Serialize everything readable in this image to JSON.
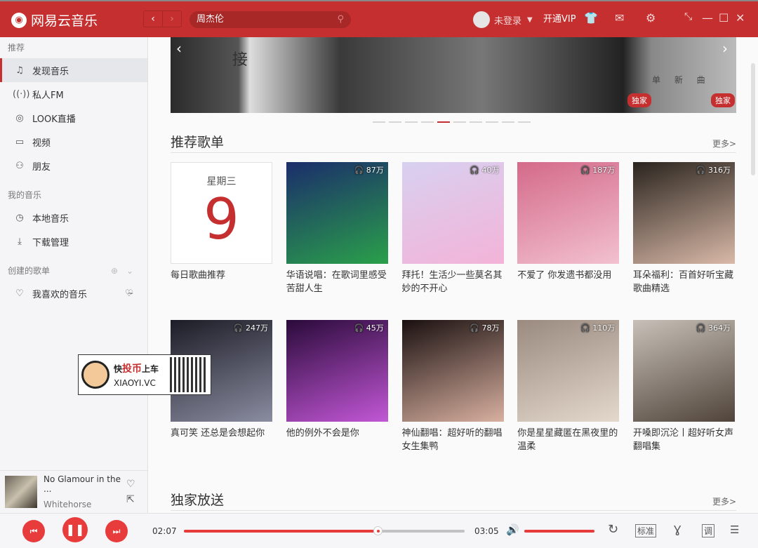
{
  "app": {
    "title": "网易云音乐",
    "search_value": "周杰伦",
    "user": "未登录",
    "vip": "开通VIP"
  },
  "sidebar": {
    "sections": [
      {
        "header": "推荐",
        "items": [
          {
            "label": "发现音乐",
            "icon": "music-note-icon",
            "active": true
          },
          {
            "label": "私人FM",
            "icon": "radio-icon"
          },
          {
            "label": "LOOK直播",
            "icon": "live-icon"
          },
          {
            "label": "视频",
            "icon": "video-icon"
          },
          {
            "label": "朋友",
            "icon": "friends-icon"
          }
        ]
      },
      {
        "header": "我的音乐",
        "items": [
          {
            "label": "本地音乐",
            "icon": "clock-icon"
          },
          {
            "label": "下载管理",
            "icon": "download-icon"
          }
        ]
      },
      {
        "header": "创建的歌单",
        "items": [
          {
            "label": "我喜欢的音乐",
            "icon": "heart-icon"
          }
        ]
      }
    ]
  },
  "now_playing": {
    "title": "No Glamour in the ...",
    "artist": "Whitehorse"
  },
  "banner": {
    "badge": "独家",
    "badge2": "独家",
    "text_left": "接",
    "text_right": "单 新 曲"
  },
  "recommended": {
    "title": "推荐歌单",
    "more": "更多>",
    "daily": {
      "weekday": "星期三",
      "day": "9",
      "title": "每日歌曲推荐"
    },
    "playlists": [
      {
        "plays": "87万",
        "title": "华语说唱：在歌词里感受苦甜人生",
        "colors": [
          "#1b2d6b",
          "#2aa04a"
        ]
      },
      {
        "plays": "40万",
        "title": "拜托！生活少一些莫名其妙的不开心",
        "colors": [
          "#d8d0f0",
          "#f3b3d8"
        ]
      },
      {
        "plays": "187万",
        "title": "不爱了 你发遗书都没用",
        "colors": [
          "#d46a8a",
          "#f2c1cf"
        ]
      },
      {
        "plays": "316万",
        "title": "耳朵福利：百首好听宝藏歌曲精选",
        "colors": [
          "#2a241e",
          "#d9b9a8"
        ]
      },
      {
        "plays": "247万",
        "title": "真可笑 还总是会想起你",
        "colors": [
          "#1c1c26",
          "#8a8ca0"
        ]
      },
      {
        "plays": "45万",
        "title": "他的例外不会是你",
        "colors": [
          "#2a0a3a",
          "#c257d6"
        ]
      },
      {
        "plays": "78万",
        "title": "神仙翻唱：超好听的翻唱女生集鸭",
        "colors": [
          "#1a1010",
          "#d8b0a0"
        ]
      },
      {
        "plays": "110万",
        "title": "你是星星藏匿在黑夜里的温柔",
        "colors": [
          "#9a8a80",
          "#e4d8cc"
        ]
      },
      {
        "plays": "364万",
        "title": "开嗓即沉沦丨超好听女声翻唱集",
        "colors": [
          "#c8c0b8",
          "#50443a"
        ]
      }
    ]
  },
  "exclusive": {
    "title": "独家放送",
    "more": "更多>"
  },
  "player": {
    "elapsed": "02:07",
    "total": "03:05",
    "progress": 0.69,
    "volume": 1.0,
    "quality": "标准",
    "lyrics": "调"
  },
  "watermark": {
    "text": "快投币上车",
    "url": "XIAOYI.VC"
  }
}
